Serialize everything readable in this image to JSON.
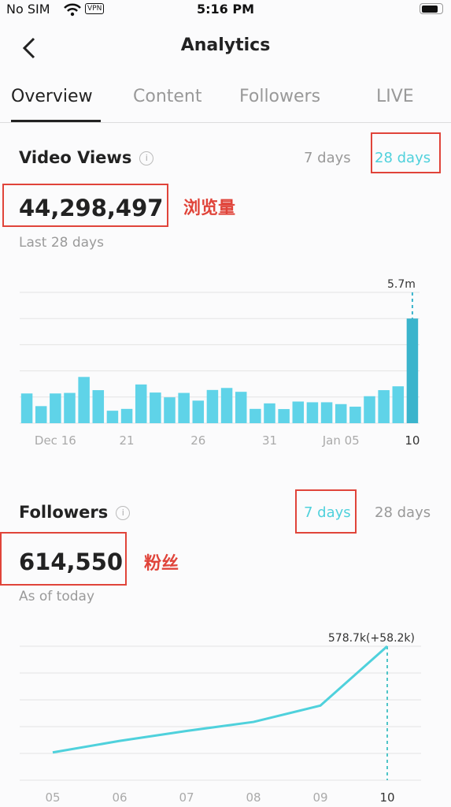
{
  "status_bar": {
    "carrier": "No SIM",
    "vpn_badge": "VPN",
    "time": "5:16 PM",
    "icons": [
      "wifi-icon",
      "battery-icon"
    ]
  },
  "header": {
    "title": "Analytics",
    "back_icon": "chevron-left-icon"
  },
  "tabs": [
    {
      "label": "Overview",
      "active": true
    },
    {
      "label": "Content",
      "active": false
    },
    {
      "label": "Followers",
      "active": false
    },
    {
      "label": "LIVE",
      "active": false
    }
  ],
  "video_views": {
    "title": "Video Views",
    "range_options": [
      "7 days",
      "28 days"
    ],
    "selected_range": "28 days",
    "value": "44,298,497",
    "annotation": "浏览量",
    "subtitle": "Last 28 days"
  },
  "followers": {
    "title": "Followers",
    "range_options": [
      "7 days",
      "28 days"
    ],
    "selected_range": "7 days",
    "value": "614,550",
    "annotation": "粉丝",
    "subtitle": "As of today"
  },
  "colors": {
    "accent": "#4fd1dc",
    "bar": "#5fd3e8",
    "bar_selected": "#3ab4cc",
    "annotation_red": "#e0443a"
  },
  "chart_data": [
    {
      "type": "bar",
      "x_tick_labels": [
        "Dec 16",
        "21",
        "26",
        "31",
        "Jan 05",
        "10"
      ],
      "x_tick_indices": [
        2,
        7,
        12,
        17,
        22,
        27
      ],
      "unit": "m",
      "values": [
        1.62,
        0.93,
        1.62,
        1.65,
        2.52,
        1.8,
        0.68,
        0.78,
        2.11,
        1.67,
        1.41,
        1.65,
        1.23,
        1.81,
        1.92,
        1.71,
        0.78,
        1.08,
        0.77,
        1.18,
        1.14,
        1.14,
        1.04,
        0.9,
        1.47,
        1.8,
        2.01,
        5.7
      ],
      "highlight_label": "5.7m",
      "ylim": [
        0,
        7.125
      ],
      "grid": true
    },
    {
      "type": "line",
      "categories": [
        "05",
        "06",
        "07",
        "08",
        "09",
        "10"
      ],
      "values": [
        474.6,
        485.9,
        495.7,
        504.5,
        520.5,
        578.7
      ],
      "unit": "k",
      "highlight_label": "578.7k(+58.2k)",
      "ylim": [
        447.4,
        578.7
      ],
      "grid": true
    }
  ]
}
